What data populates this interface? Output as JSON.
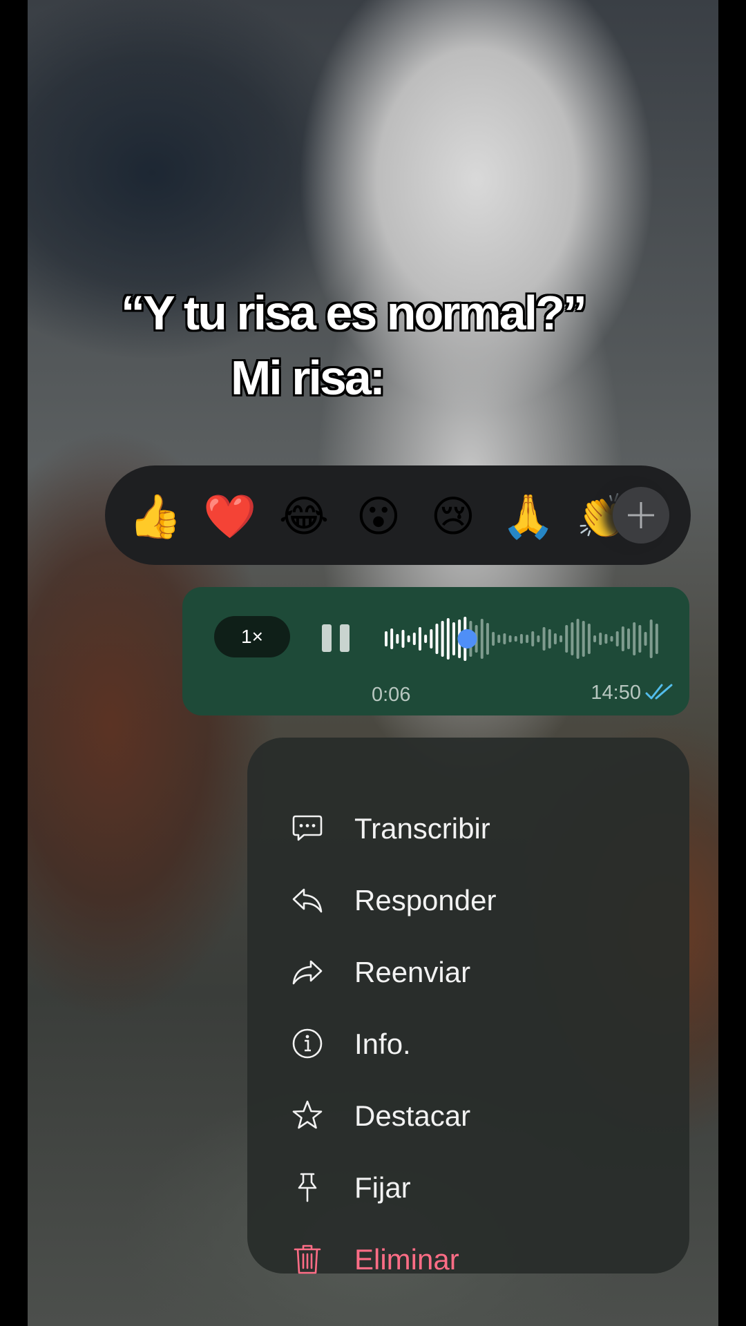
{
  "caption": {
    "line1": "“Y tu risa es normal?”",
    "line2": "Mi risa:"
  },
  "reactions": {
    "items": [
      {
        "emoji": "👍",
        "name": "thumbs-up"
      },
      {
        "emoji": "❤️",
        "name": "heart"
      },
      {
        "emoji": "😂",
        "name": "tears-of-joy"
      },
      {
        "emoji": "😮",
        "name": "surprised"
      },
      {
        "emoji": "😢",
        "name": "crying"
      },
      {
        "emoji": "🙏",
        "name": "folded-hands"
      },
      {
        "emoji": "👏",
        "name": "clapping-hands"
      }
    ],
    "more_icon": "plus-icon"
  },
  "voice_message": {
    "speed": "1×",
    "playback_state": "paused-icon",
    "progress": 0.3,
    "elapsed": "0:06",
    "sent_time": "14:50",
    "read_status": "double-check-icon",
    "colors": {
      "bubble": "#1e4a38",
      "played": "#ffffff",
      "unplayed": "#7f9c8f",
      "thumb": "#4f8ff7",
      "read_ticks": "#53bdeb"
    }
  },
  "menu": {
    "items": [
      {
        "label": "Transcribir",
        "icon": "speech-bubble-icon"
      },
      {
        "label": "Responder",
        "icon": "reply-icon"
      },
      {
        "label": "Reenviar",
        "icon": "forward-icon"
      },
      {
        "label": "Info.",
        "icon": "info-icon"
      },
      {
        "label": "Destacar",
        "icon": "star-icon"
      },
      {
        "label": "Fijar",
        "icon": "pin-icon"
      },
      {
        "label": "Eliminar",
        "icon": "trash-icon",
        "destructive": true
      }
    ],
    "destructive_color": "#ff6d86"
  }
}
